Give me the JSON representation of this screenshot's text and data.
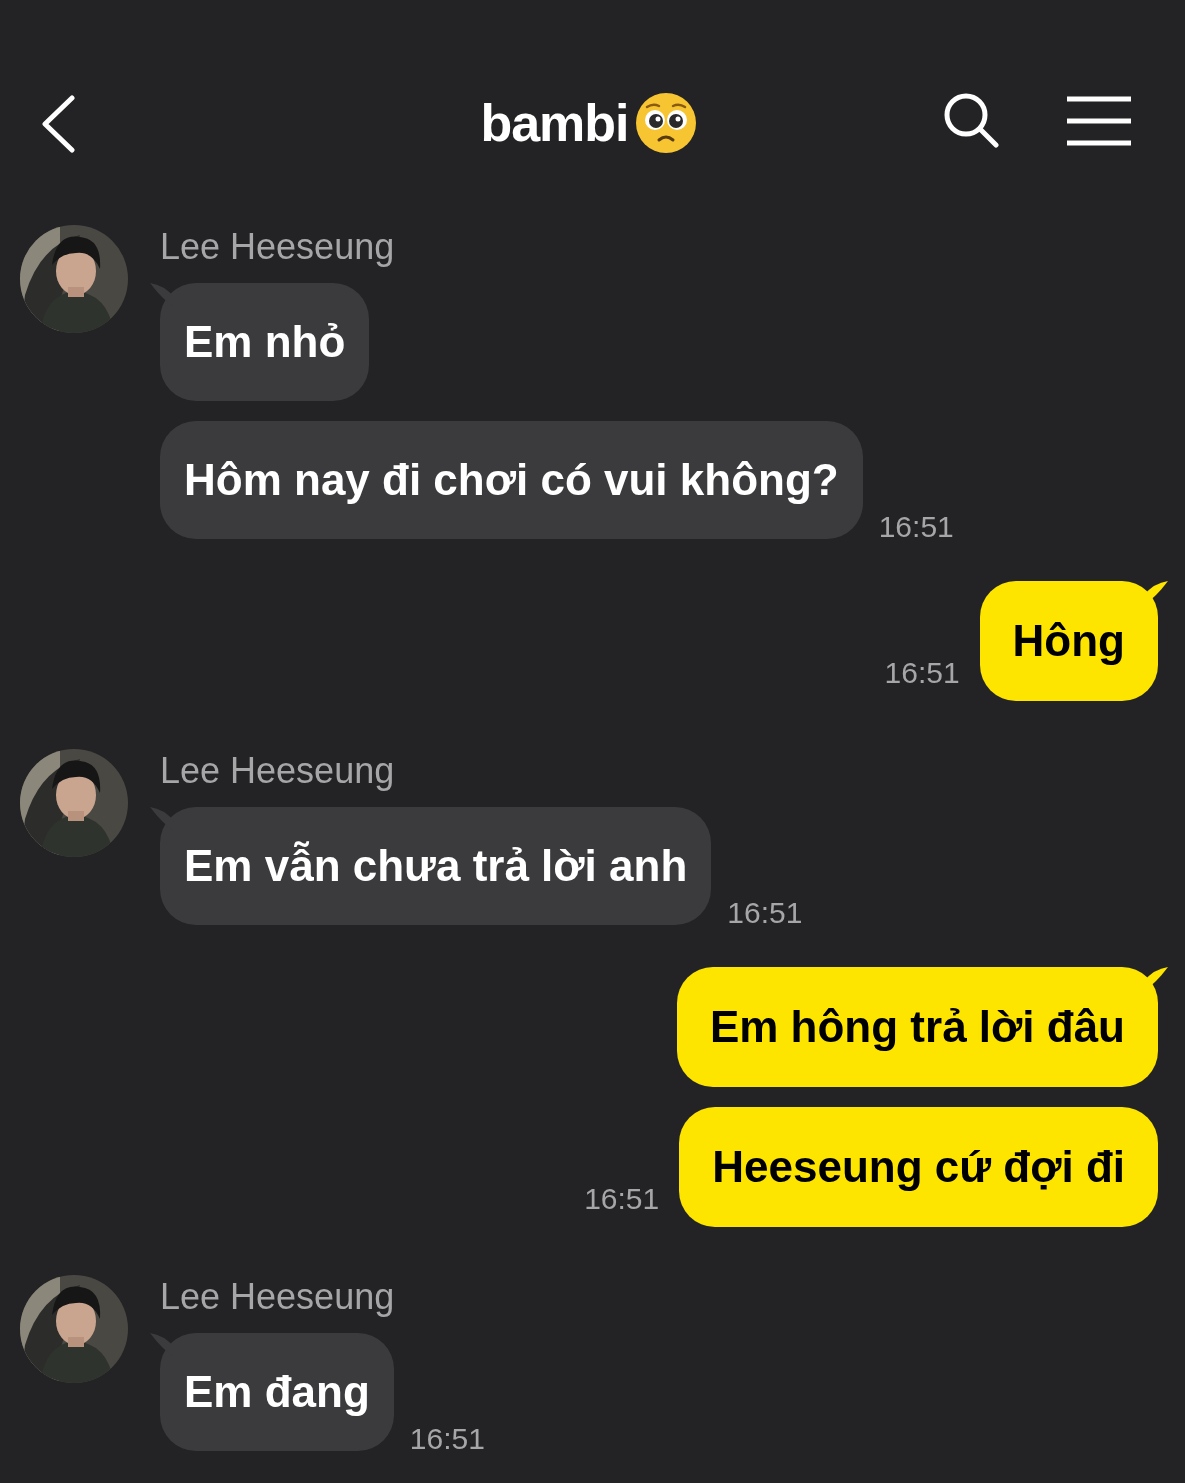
{
  "header": {
    "title": "bambi"
  },
  "messages": [
    {
      "kind": "received",
      "sender": "Lee Heeseung",
      "bubbles": [
        "Em nhỏ",
        "Hôm nay đi chơi có vui không?"
      ],
      "time": "16:51"
    },
    {
      "kind": "sent",
      "bubbles": [
        "Hông"
      ],
      "time": "16:51"
    },
    {
      "kind": "received",
      "sender": "Lee Heeseung",
      "bubbles": [
        "Em vẫn chưa trả lời anh"
      ],
      "time": "16:51"
    },
    {
      "kind": "sent",
      "bubbles": [
        "Em hông trả lời đâu",
        "Heeseung cứ đợi đi"
      ],
      "time": "16:51"
    },
    {
      "kind": "received",
      "sender": "Lee Heeseung",
      "bubbles": [
        "Em đang"
      ],
      "time": "16:51"
    }
  ]
}
